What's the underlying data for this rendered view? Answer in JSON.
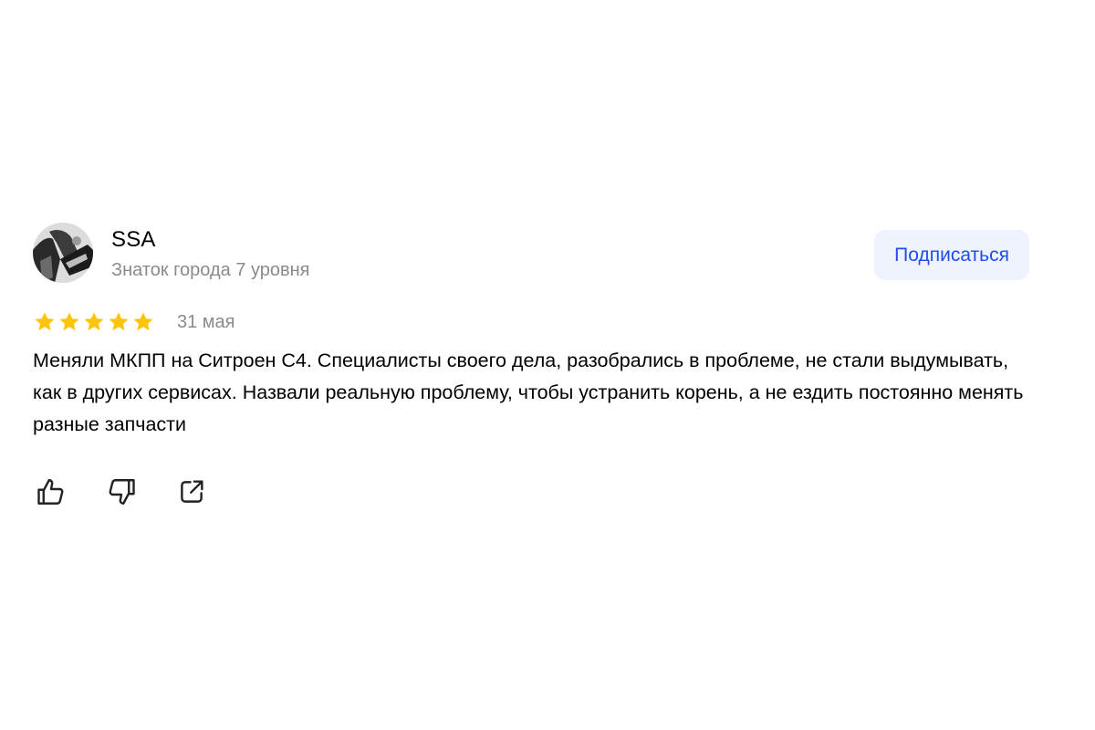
{
  "review": {
    "author": {
      "name": "SSA",
      "level": "Знаток города 7 уровня",
      "avatar_icon": "user-photo-avatar"
    },
    "subscribe_label": "Подписаться",
    "rating": {
      "value": 5,
      "max": 5
    },
    "date": "31 мая",
    "text": "Меняли МКПП на Ситроен С4. Специалисты своего дела, разобрались в проблеме, не стали выдумывать, как в других сервисах. Назвали реальную проблему, чтобы устранить корень, а не ездить постоянно менять разные запчасти",
    "actions": [
      {
        "icon": "thumbs-up-icon"
      },
      {
        "icon": "thumbs-down-icon"
      },
      {
        "icon": "share-icon"
      }
    ]
  },
  "colors": {
    "star": "#fcc50c",
    "muted_text": "#8a8a8a",
    "accent": "#1f4df0",
    "button_bg": "#eef3fe"
  }
}
